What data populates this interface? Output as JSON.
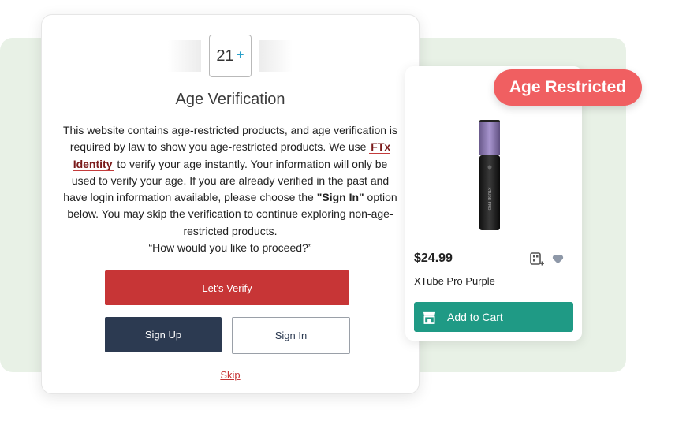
{
  "age_badge": {
    "number": "21",
    "suffix": "+"
  },
  "modal": {
    "title": "Age Verification",
    "body_part1": "This website contains age-restricted products, and age verification is required by law to show you age-restricted products. We use ",
    "brand": "FTx Identity",
    "body_part2": " to verify your age instantly. Your information will only be used to verify your age. If you are already verified in the past and have login information available, please choose the ",
    "sign_in_quote": "\"Sign In\"",
    "body_part3": " option below. You may skip the verification to continue exploring non-age-restricted products.",
    "question": "“How would you like to proceed?”",
    "verify_label": "Let's Verify",
    "signup_label": "Sign Up",
    "signin_label": "Sign In",
    "skip_label": "Skip"
  },
  "product": {
    "price": "$24.99",
    "name": "XTube Pro Purple",
    "add_to_cart_label": "Add to Cart",
    "restricted_badge": "Age Restricted",
    "image_text": "XTUBE PRO"
  },
  "colors": {
    "verify_red": "#c73536",
    "signup_navy": "#2c3a51",
    "cart_teal": "#1f9a85",
    "badge_coral": "#f05f61",
    "background_green": "#e8f1e6"
  },
  "icons": [
    "compare-icon",
    "heart-icon",
    "store-icon"
  ]
}
